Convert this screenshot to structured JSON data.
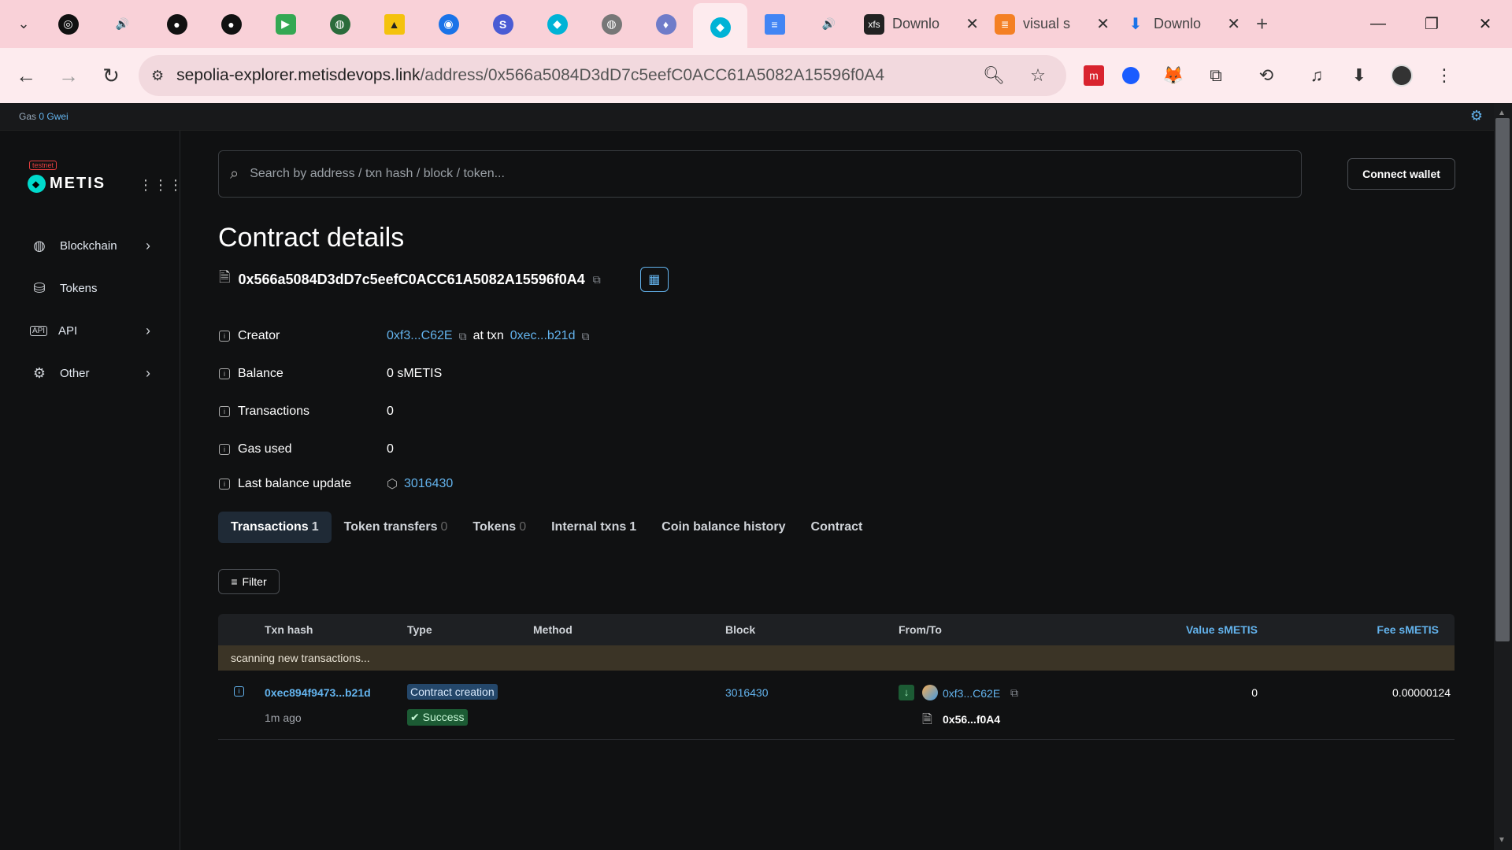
{
  "browser": {
    "tabs": [
      {
        "label": "Downlo",
        "icon": "xfs-icon"
      },
      {
        "label": "visual s",
        "icon": "stackoverflow-icon"
      },
      {
        "label": "Downlo",
        "icon": "download-icon"
      }
    ],
    "url_domain": "sepolia-explorer.metisdevops.link",
    "url_path": "/address/0x566a5084D3dD7c5eefC0ACC61A5082A15596f0A4"
  },
  "gasbar": {
    "label": "Gas",
    "value": "0 Gwei"
  },
  "sidebar": {
    "badge": "testnet",
    "brand": "METIS",
    "items": [
      {
        "label": "Blockchain",
        "icon": "globe-icon"
      },
      {
        "label": "Tokens",
        "icon": "tokens-icon"
      },
      {
        "label": "API",
        "icon": "api-icon"
      },
      {
        "label": "Other",
        "icon": "gear-icon"
      }
    ]
  },
  "search": {
    "placeholder": "Search by address / txn hash / block / token..."
  },
  "connect_label": "Connect wallet",
  "page_title": "Contract details",
  "address": "0x566a5084D3dD7c5eefC0ACC61A5082A15596f0A4",
  "details": {
    "creator_label": "Creator",
    "creator_value": "0xf3...C62E",
    "at_txn_label": "at txn",
    "at_txn_value": "0xec...b21d",
    "balance_label": "Balance",
    "balance_value": "0 sMETIS",
    "transactions_label": "Transactions",
    "transactions_value": "0",
    "gas_label": "Gas used",
    "gas_value": "0",
    "last_update_label": "Last balance update",
    "last_update_value": "3016430"
  },
  "tabs": [
    {
      "label": "Transactions",
      "count": "1"
    },
    {
      "label": "Token transfers",
      "count": "0"
    },
    {
      "label": "Tokens",
      "count": "0"
    },
    {
      "label": "Internal txns",
      "count": "1"
    },
    {
      "label": "Coin balance history",
      "count": ""
    },
    {
      "label": "Contract",
      "count": ""
    }
  ],
  "filter_label": "Filter",
  "table": {
    "headers": {
      "txn_hash": "Txn hash",
      "type": "Type",
      "method": "Method",
      "block": "Block",
      "from_to": "From/To",
      "value": "Value sMETIS",
      "fee": "Fee sMETIS"
    },
    "scanning": "scanning new transactions...",
    "rows": [
      {
        "hash": "0xec894f9473...b21d",
        "age": "1m ago",
        "type": "Contract creation",
        "status": "Success",
        "method": "",
        "block": "3016430",
        "from": "0xf3...C62E",
        "to": "0x56...f0A4",
        "value": "0",
        "fee": "0.00000124"
      }
    ]
  },
  "colors": {
    "accent": "#63b3ed",
    "background": "#101112",
    "tabstrip": "#f9d1d8"
  }
}
